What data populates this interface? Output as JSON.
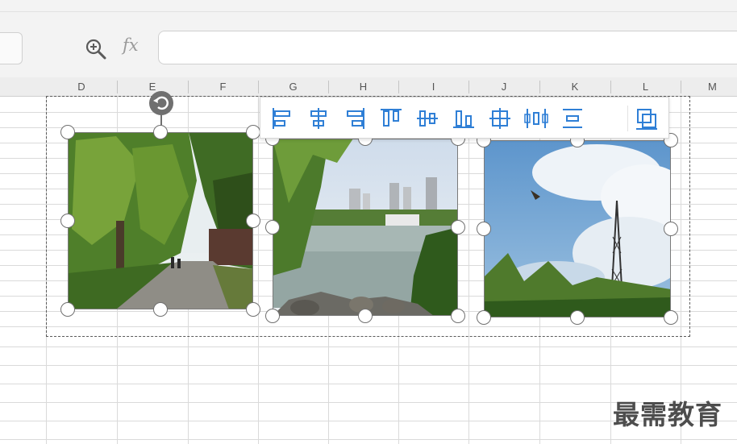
{
  "formula_bar": {
    "fx_label": "fx",
    "zoom_icon": "zoom-in-icon",
    "input_value": ""
  },
  "column_headers": [
    "D",
    "E",
    "F",
    "G",
    "H",
    "I",
    "J",
    "K",
    "L",
    "M"
  ],
  "images": [
    {
      "name": "willow-path-photo",
      "description": "tree"
    },
    {
      "name": "lake-photo",
      "description": "lake"
    },
    {
      "name": "tower-photo",
      "description": "tower"
    }
  ],
  "align_toolbar": {
    "tools": [
      "align-left-icon",
      "align-center-horizontal-icon",
      "align-right-icon",
      "align-top-icon",
      "align-middle-vertical-icon",
      "align-bottom-icon",
      "center-on-page-icon",
      "distribute-horizontally-icon",
      "distribute-vertically-icon",
      "group-objects-icon"
    ],
    "accent_color": "#2f7fd6"
  },
  "watermark": "最需教育",
  "colors": {
    "header_bg": "#ededed",
    "grid_line": "#dadada",
    "icon_blue": "#2f7fd6",
    "handle_border": "#707070"
  }
}
